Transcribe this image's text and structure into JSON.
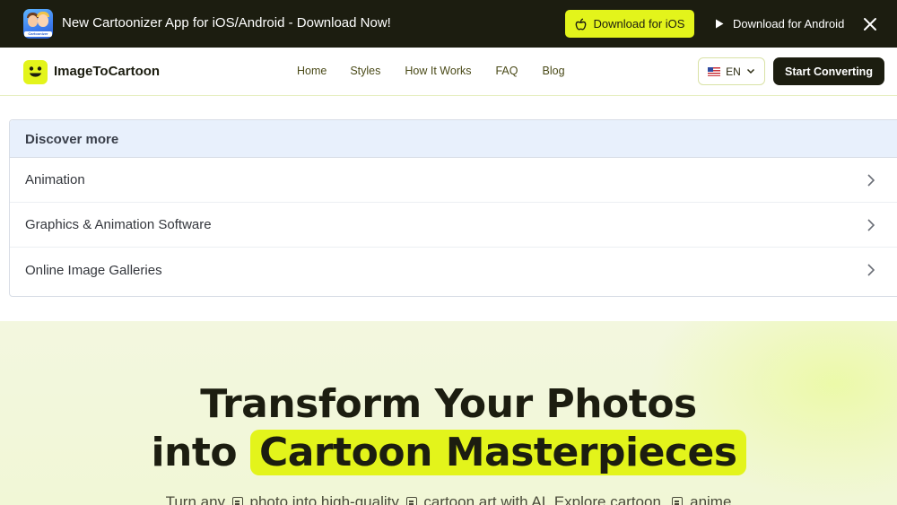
{
  "promo": {
    "text": "New Cartoonizer App for iOS/Android - Download Now!",
    "app_icon_caption": "Cartoonizer",
    "ios_button": "Download for iOS",
    "android_button": "Download for Android"
  },
  "nav": {
    "logo": "ImageToCartoon",
    "links": [
      "Home",
      "Styles",
      "How It Works",
      "FAQ",
      "Blog"
    ],
    "language": "EN",
    "cta": "Start Converting"
  },
  "discover": {
    "heading": "Discover more",
    "items": [
      "Animation",
      "Graphics & Animation Software",
      "Online Image Galleries"
    ]
  },
  "hero": {
    "title_line1": "Transform Your Photos",
    "title_into": "into",
    "title_highlight": "Cartoon Masterpieces",
    "subtitle_parts": [
      "Turn any",
      "photo into high-quality",
      "cartoon art with AI. Explore cartoon,",
      "anime"
    ]
  },
  "colors": {
    "accent": "#e3f41b",
    "dark": "#1c1d10",
    "panel_head": "#e8f0fc",
    "hero_bg": "#f3f7df"
  }
}
